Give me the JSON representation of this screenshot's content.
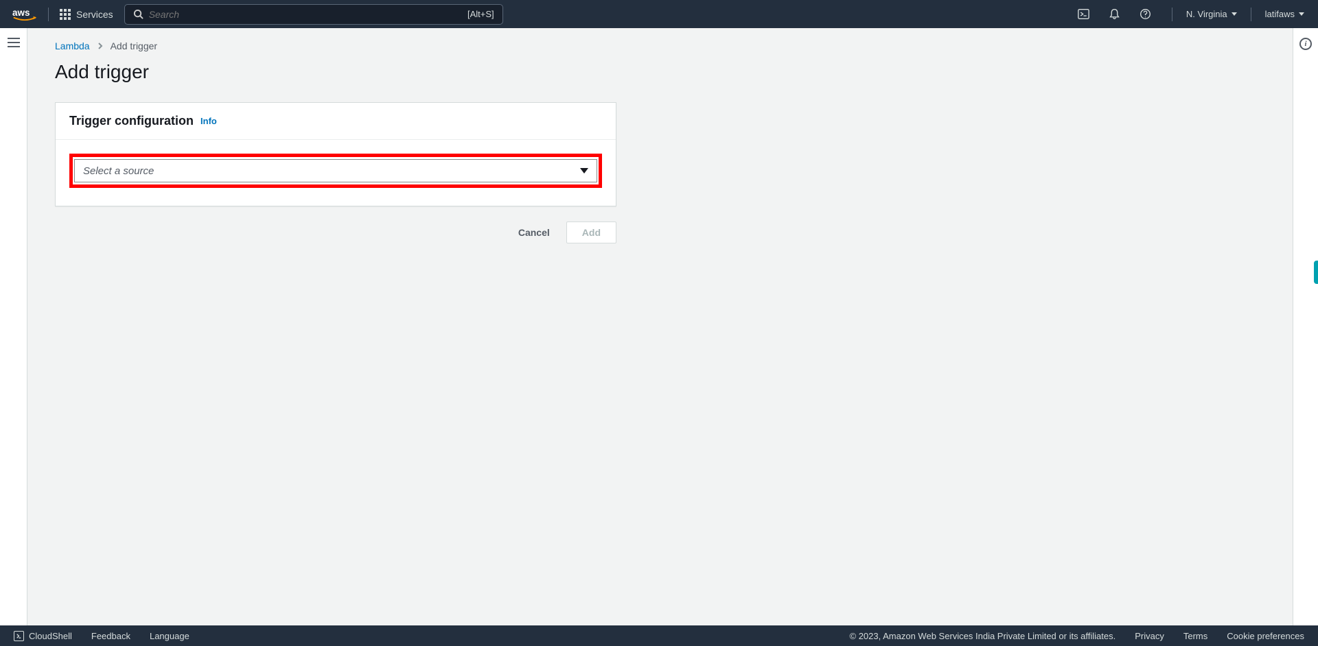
{
  "topnav": {
    "services_label": "Services",
    "search_placeholder": "Search",
    "search_hint": "[Alt+S]",
    "region": "N. Virginia",
    "account": "latifaws"
  },
  "breadcrumbs": {
    "parent": "Lambda",
    "current": "Add trigger"
  },
  "page": {
    "title": "Add trigger"
  },
  "panel": {
    "header_title": "Trigger configuration",
    "info_label": "Info",
    "select_placeholder": "Select a source"
  },
  "actions": {
    "cancel": "Cancel",
    "add": "Add"
  },
  "footer": {
    "cloudshell": "CloudShell",
    "feedback": "Feedback",
    "language": "Language",
    "copyright": "© 2023, Amazon Web Services India Private Limited or its affiliates.",
    "privacy": "Privacy",
    "terms": "Terms",
    "cookie": "Cookie preferences"
  }
}
